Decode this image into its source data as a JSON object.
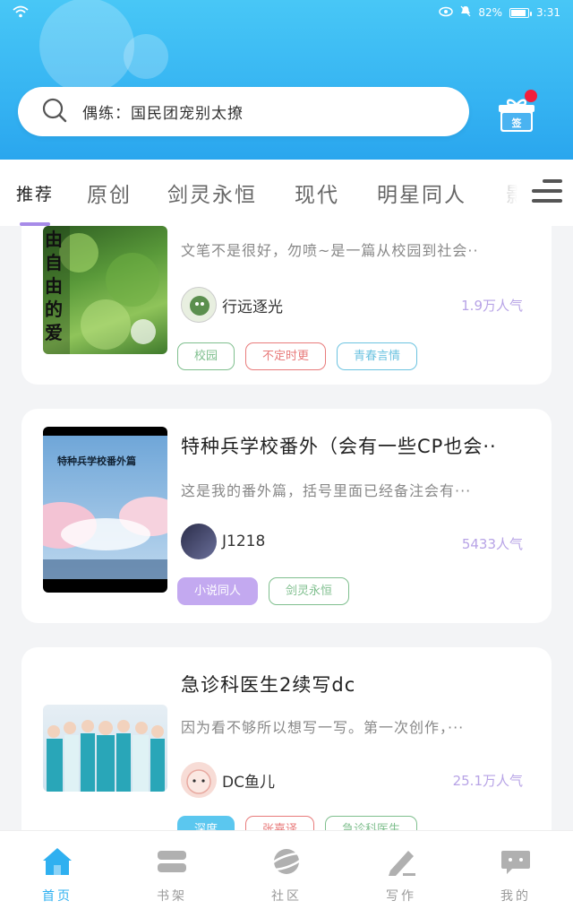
{
  "status": {
    "battery": "82%",
    "time": "3:31"
  },
  "search": {
    "placeholder": "偶练：国民团宠别太撩"
  },
  "gift": {
    "label": "签"
  },
  "tabs": [
    {
      "label": "推荐",
      "active": true
    },
    {
      "label": "原创"
    },
    {
      "label": "剑灵永恒"
    },
    {
      "label": "现代"
    },
    {
      "label": "明星同人"
    },
    {
      "label": "影"
    }
  ],
  "cards": [
    {
      "title": "",
      "desc": "文笔不是很好，勿喷~是一篇从校园到社会··",
      "author": "行远逐光",
      "popularity": "1.9万人气",
      "cover_text": "由自由的爱~",
      "tags": [
        {
          "label": "校园",
          "color": "#7fbf8e"
        },
        {
          "label": "不定时更",
          "color": "#e87b7b"
        },
        {
          "label": "青春言情",
          "color": "#6cc3e0"
        }
      ]
    },
    {
      "title": "特种兵学校番外（会有一些CP也会··",
      "desc": "这是我的番外篇，括号里面已经备注会有···",
      "author": "J1218",
      "popularity": "5433人气",
      "cover_text": "特种兵学校番外篇",
      "tags": [
        {
          "label": "小说同人",
          "color": "#c3a9f0",
          "filled": true
        },
        {
          "label": "剑灵永恒",
          "color": "#7fbf8e"
        }
      ]
    },
    {
      "title": "急诊科医生2续写dc",
      "desc": "因为看不够所以想写一写。第一次创作，···",
      "author": "DC鱼儿",
      "popularity": "25.1万人气",
      "tags": [
        {
          "label": "深度",
          "color": "#5bc7ef",
          "filled": true
        },
        {
          "label": "张嘉译",
          "color": "#e87b7b"
        },
        {
          "label": "急诊科医生",
          "color": "#7fbf8e"
        }
      ]
    }
  ],
  "nav": [
    {
      "label": "首页",
      "icon": "home-icon",
      "active": true
    },
    {
      "label": "书架",
      "icon": "bookshelf-icon"
    },
    {
      "label": "社区",
      "icon": "community-icon"
    },
    {
      "label": "写作",
      "icon": "pen-icon"
    },
    {
      "label": "我的",
      "icon": "chat-bubble-icon"
    }
  ],
  "colors": {
    "accent": "#2fb0f0",
    "tab_indicator": "#a78be8",
    "popularity": "#b7a3e6"
  }
}
